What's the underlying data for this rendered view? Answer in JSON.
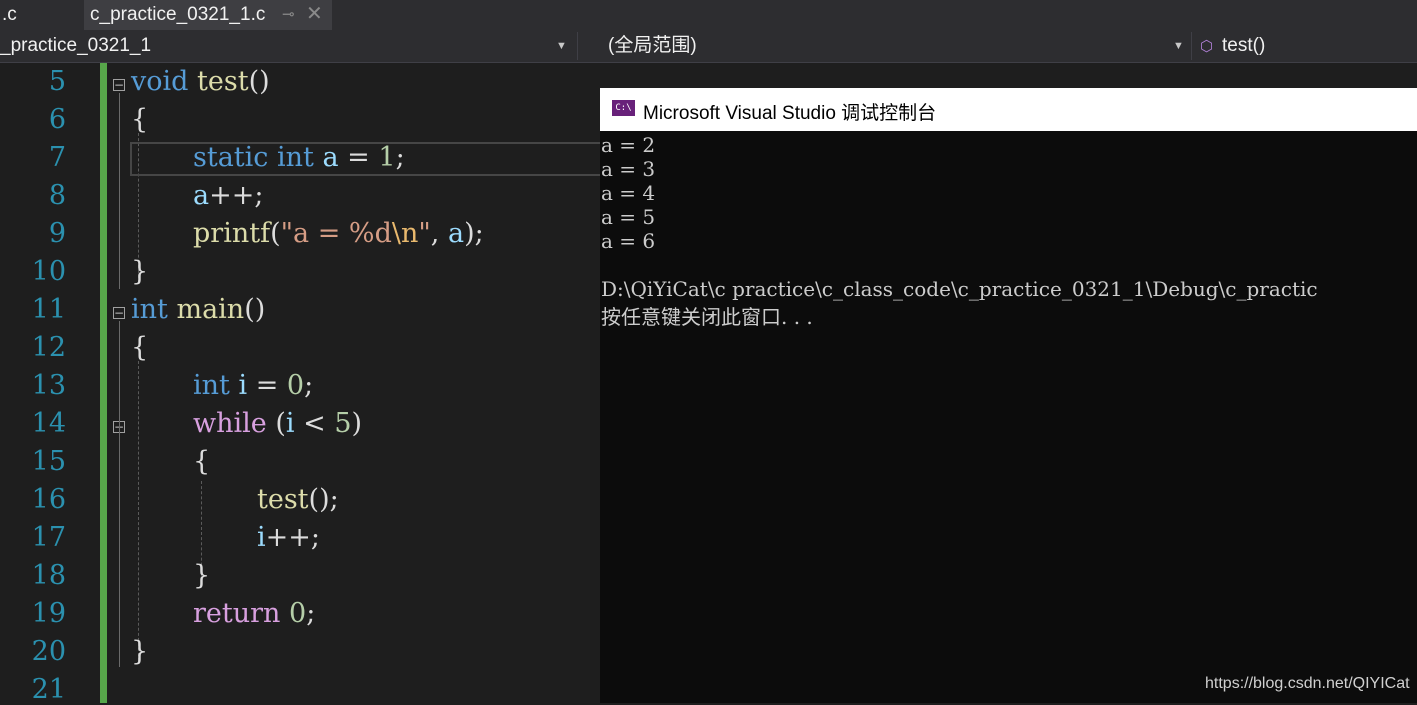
{
  "tabs": [
    {
      "label": ".c"
    },
    {
      "label": "c_practice_0321_1.c",
      "pin_icon": "pin-icon",
      "close_icon": "close-icon"
    }
  ],
  "navbar": {
    "project": "_practice_0321_1",
    "scope": "(全局范围)",
    "member": "test()",
    "member_icon": "method-cube-icon"
  },
  "editor": {
    "line_numbers": [
      "5",
      "6",
      "7",
      "8",
      "9",
      "10",
      "11",
      "12",
      "13",
      "14",
      "15",
      "16",
      "17",
      "18",
      "19",
      "20",
      "21"
    ],
    "tokens": {
      "void": "void",
      "test": "test",
      "parens": "()",
      "brace_open": "{",
      "brace_close": "}",
      "static": "static",
      "int": "int",
      "a": "a",
      "assign": " = ",
      "one": "1",
      "semi": ";",
      "incr": "++;",
      "printf": "printf",
      "paren_open": "(",
      "paren_close": ")",
      "fmt_open": "\"a = %d",
      "fmt_esc": "\\n",
      "fmt_close": "\"",
      "comma_space": ", ",
      "close_semi": ");",
      "main": "main",
      "i": "i",
      "zero": "0",
      "while": "while",
      "lt": " < ",
      "five": "5",
      "call_semi": "();",
      "return": "return"
    }
  },
  "console": {
    "title": "Microsoft Visual Studio 调试控制台",
    "title_icon": "console-app-icon",
    "title_icon_text": "C:\\",
    "lines": [
      "a = 2",
      "a = 3",
      "a = 4",
      "a = 5",
      "a = 6",
      "",
      "D:\\QiYiCat\\c practice\\c_class_code\\c_practice_0321_1\\Debug\\c_practic",
      "按任意键关闭此窗口. . ."
    ]
  },
  "watermark": "https://blog.csdn.net/QIYICat",
  "colors": {
    "background": "#1e1e1e",
    "keyword": "#569cd6",
    "control_keyword": "#d8a0df",
    "function": "#dcdcaa",
    "variable": "#9cdcfe",
    "number": "#b5cea8",
    "string": "#d69d85",
    "line_number": "#2b91af",
    "change_bar": "#57a64a"
  }
}
